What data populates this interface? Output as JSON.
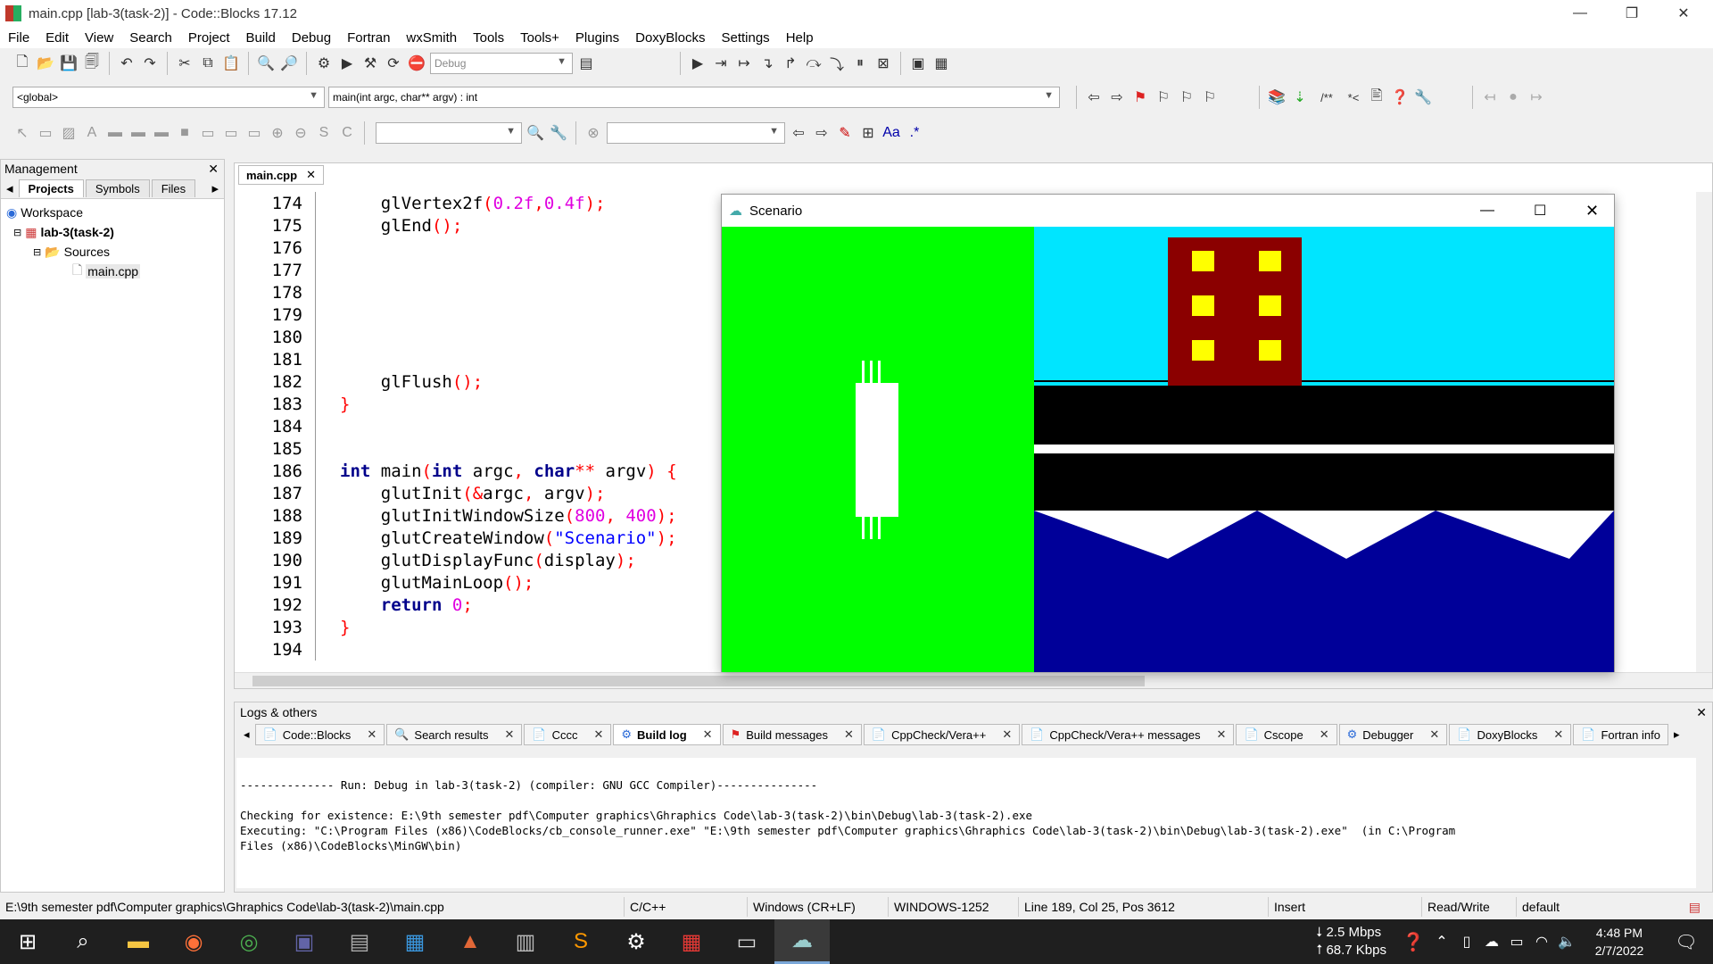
{
  "window": {
    "title": "main.cpp [lab-3(task-2)] - Code::Blocks 17.12"
  },
  "menu": [
    "File",
    "Edit",
    "View",
    "Search",
    "Project",
    "Build",
    "Debug",
    "Fortran",
    "wxSmith",
    "Tools",
    "Tools+",
    "Plugins",
    "DoxyBlocks",
    "Settings",
    "Help"
  ],
  "toolbar": {
    "build_target": "Debug",
    "scope": "<global>",
    "function": "main(int argc, char** argv) : int"
  },
  "management": {
    "title": "Management",
    "tabs": [
      "Projects",
      "Symbols",
      "Files"
    ],
    "tree": {
      "workspace": "Workspace",
      "project": "lab-3(task-2)",
      "folder": "Sources",
      "file": "main.cpp"
    }
  },
  "editor": {
    "tab": "main.cpp",
    "lines": [
      {
        "n": "174",
        "code": "    glVertex2f(0.2f,0.4f);"
      },
      {
        "n": "175",
        "code": "    glEnd();"
      },
      {
        "n": "176",
        "code": ""
      },
      {
        "n": "177",
        "code": ""
      },
      {
        "n": "178",
        "code": ""
      },
      {
        "n": "179",
        "code": ""
      },
      {
        "n": "180",
        "code": ""
      },
      {
        "n": "181",
        "code": ""
      },
      {
        "n": "182",
        "code": "    glFlush();"
      },
      {
        "n": "183",
        "code": "}"
      },
      {
        "n": "184",
        "code": ""
      },
      {
        "n": "185",
        "code": ""
      },
      {
        "n": "186",
        "code": "int main(int argc, char** argv) {"
      },
      {
        "n": "187",
        "code": "    glutInit(&argc, argv);"
      },
      {
        "n": "188",
        "code": "    glutInitWindowSize(800, 400);"
      },
      {
        "n": "189",
        "code": "    glutCreateWindow(\"Scenario\");"
      },
      {
        "n": "190",
        "code": "    glutDisplayFunc(display);"
      },
      {
        "n": "191",
        "code": "    glutMainLoop();"
      },
      {
        "n": "192",
        "code": "    return 0;"
      },
      {
        "n": "193",
        "code": "}"
      },
      {
        "n": "194",
        "code": ""
      }
    ]
  },
  "scenario": {
    "title": "Scenario"
  },
  "logs": {
    "title": "Logs & others",
    "tabs": [
      "Code::Blocks",
      "Search results",
      "Cccc",
      "Build log",
      "Build messages",
      "CppCheck/Vera++",
      "CppCheck/Vera++ messages",
      "Cscope",
      "Debugger",
      "DoxyBlocks",
      "Fortran info"
    ],
    "active_tab": "Build log",
    "text": "-------------- Run: Debug in lab-3(task-2) (compiler: GNU GCC Compiler)---------------\n\nChecking for existence: E:\\9th semester pdf\\Computer graphics\\Ghraphics Code\\lab-3(task-2)\\bin\\Debug\\lab-3(task-2).exe\nExecuting: \"C:\\Program Files (x86)\\CodeBlocks/cb_console_runner.exe\" \"E:\\9th semester pdf\\Computer graphics\\Ghraphics Code\\lab-3(task-2)\\bin\\Debug\\lab-3(task-2).exe\"  (in C:\\Program\nFiles (x86)\\CodeBlocks\\MinGW\\bin)"
  },
  "status": {
    "path": "E:\\9th semester pdf\\Computer graphics\\Ghraphics Code\\lab-3(task-2)\\main.cpp",
    "lang": "C/C++",
    "eol": "Windows (CR+LF)",
    "encoding": "WINDOWS-1252",
    "position": "Line 189, Col 25, Pos 3612",
    "mode": "Insert",
    "access": "Read/Write",
    "profile": "default"
  },
  "taskbar": {
    "net_down": "2.5 Mbps",
    "net_up": "68.7 Kbps",
    "time": "4:48 PM",
    "date": "2/7/2022"
  },
  "colors": {
    "grass": "#00ff00",
    "sky": "#00e5ff",
    "building": "#8b0000",
    "window": "#ffff00",
    "road": "#000000",
    "water": "#000099"
  }
}
